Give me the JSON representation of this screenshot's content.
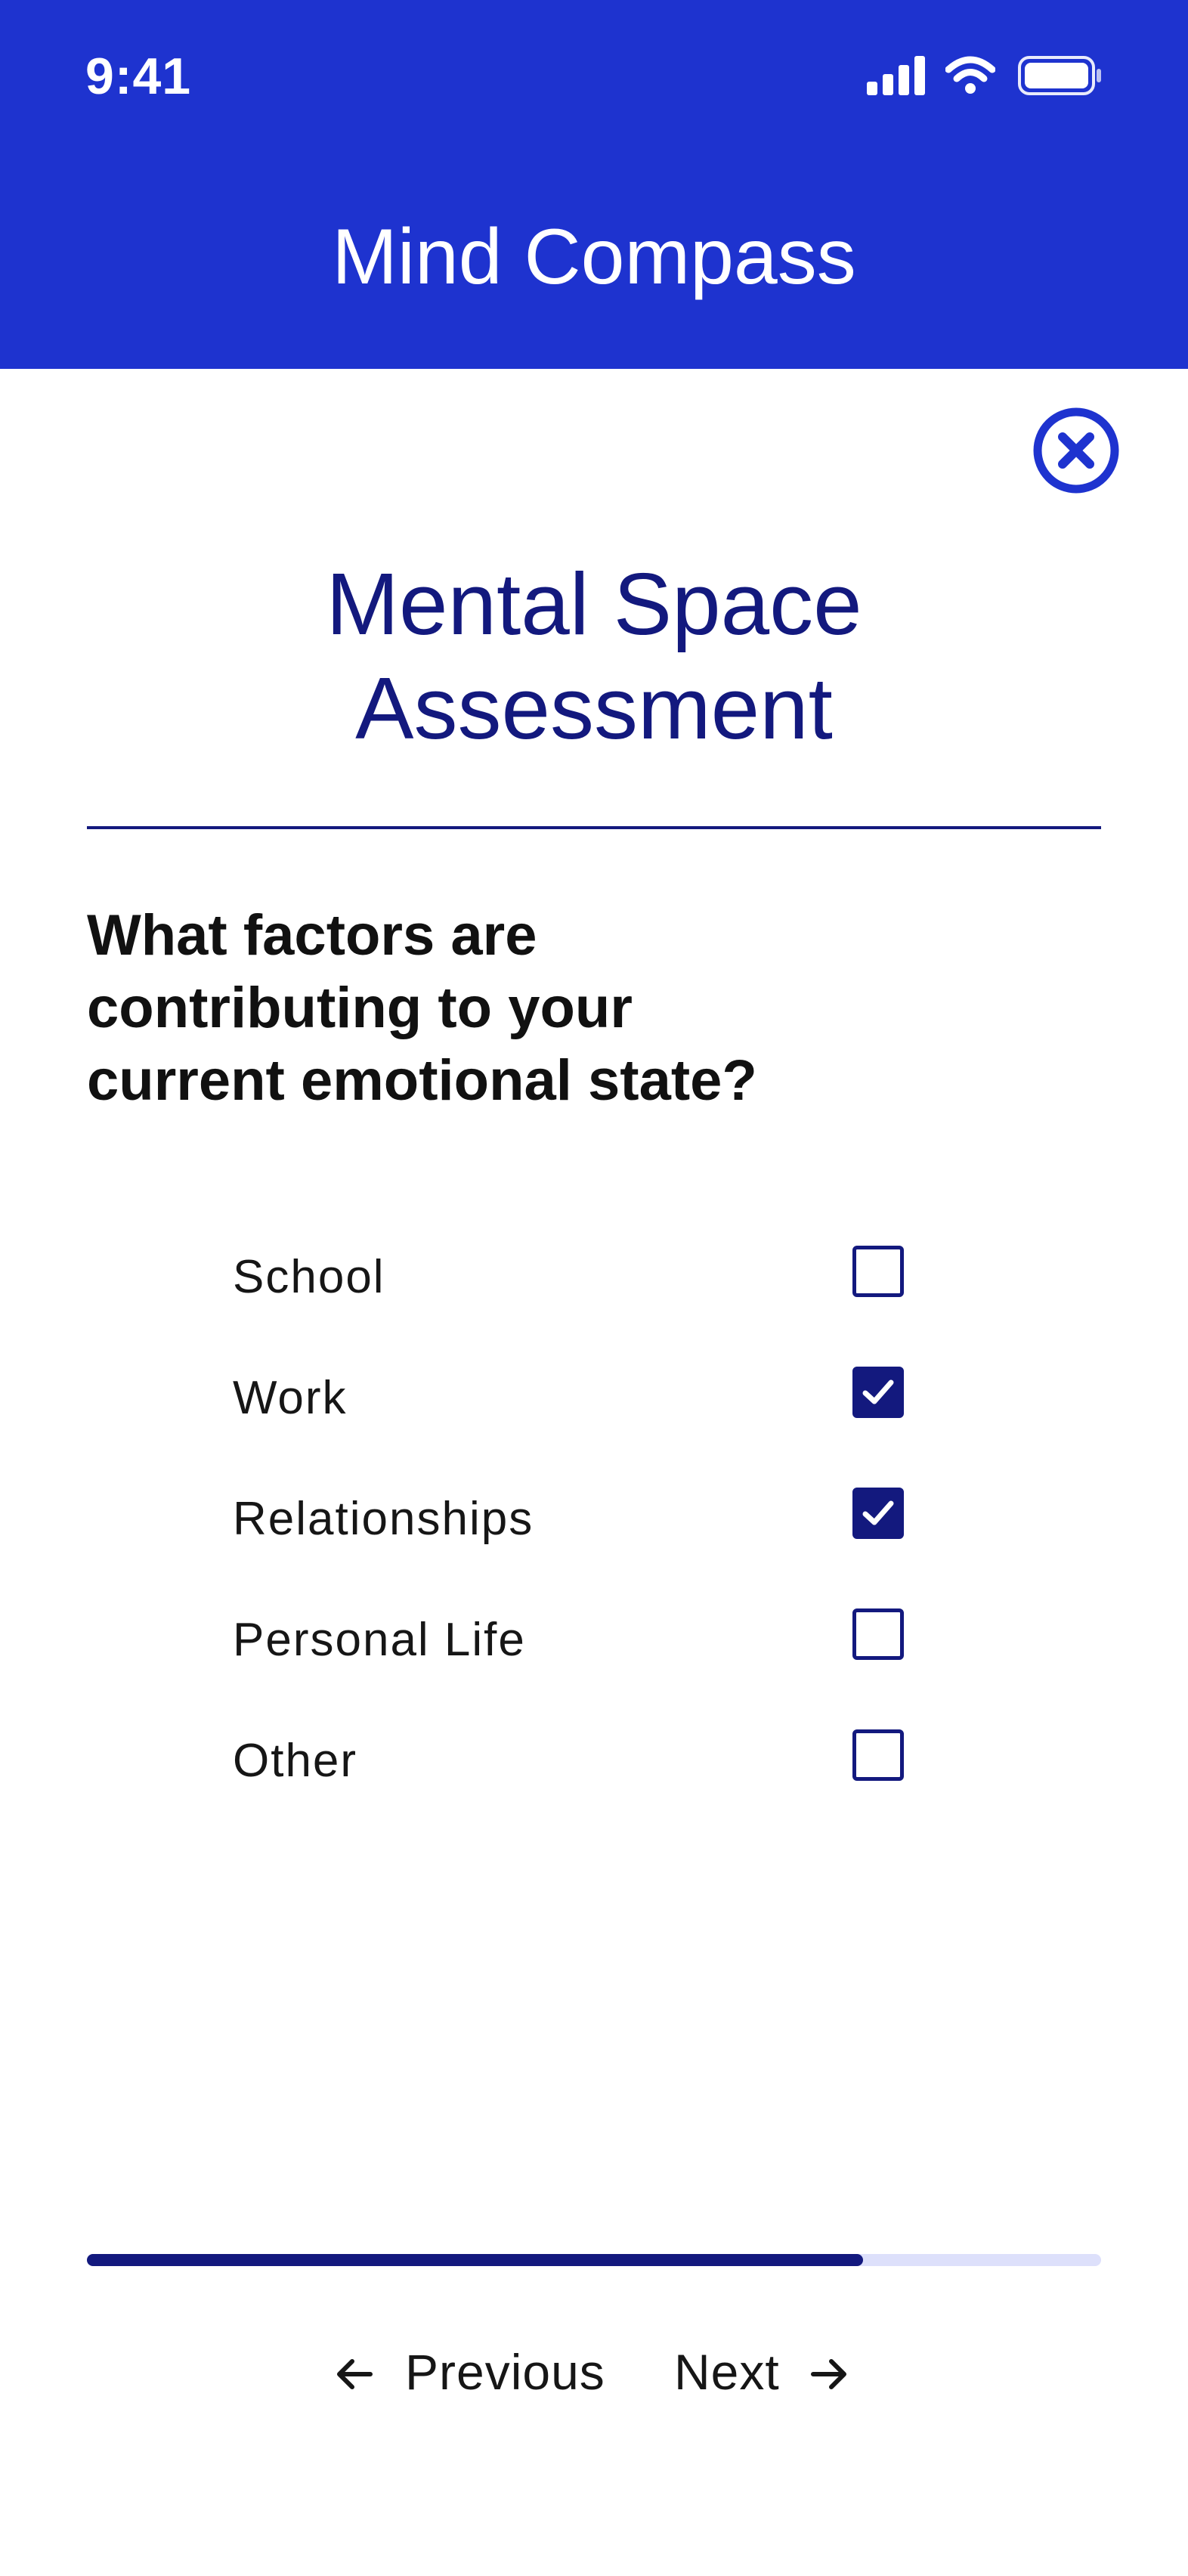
{
  "status_bar": {
    "time": "9:41",
    "icons": [
      "signal-icon",
      "wifi-icon",
      "battery-icon"
    ]
  },
  "header": {
    "title": "Mind Compass",
    "background_color": "#1e33cf"
  },
  "close_icon": "close-icon",
  "page": {
    "title_line1": "Mental Space",
    "title_line2": "Assessment"
  },
  "question": {
    "line1": "What factors are",
    "line2": "contributing to your",
    "line3": "current emotional state?"
  },
  "options": [
    {
      "label": "School",
      "checked": false
    },
    {
      "label": "Work",
      "checked": true
    },
    {
      "label": "Relationships",
      "checked": true
    },
    {
      "label": "Personal Life",
      "checked": false
    },
    {
      "label": "Other",
      "checked": false
    }
  ],
  "progress": {
    "fraction": 0.765
  },
  "navigation": {
    "previous_label": "Previous",
    "next_label": "Next"
  },
  "colors": {
    "accent": "#13197e",
    "brand": "#1e33cf",
    "progress_track": "#dde0fb"
  }
}
